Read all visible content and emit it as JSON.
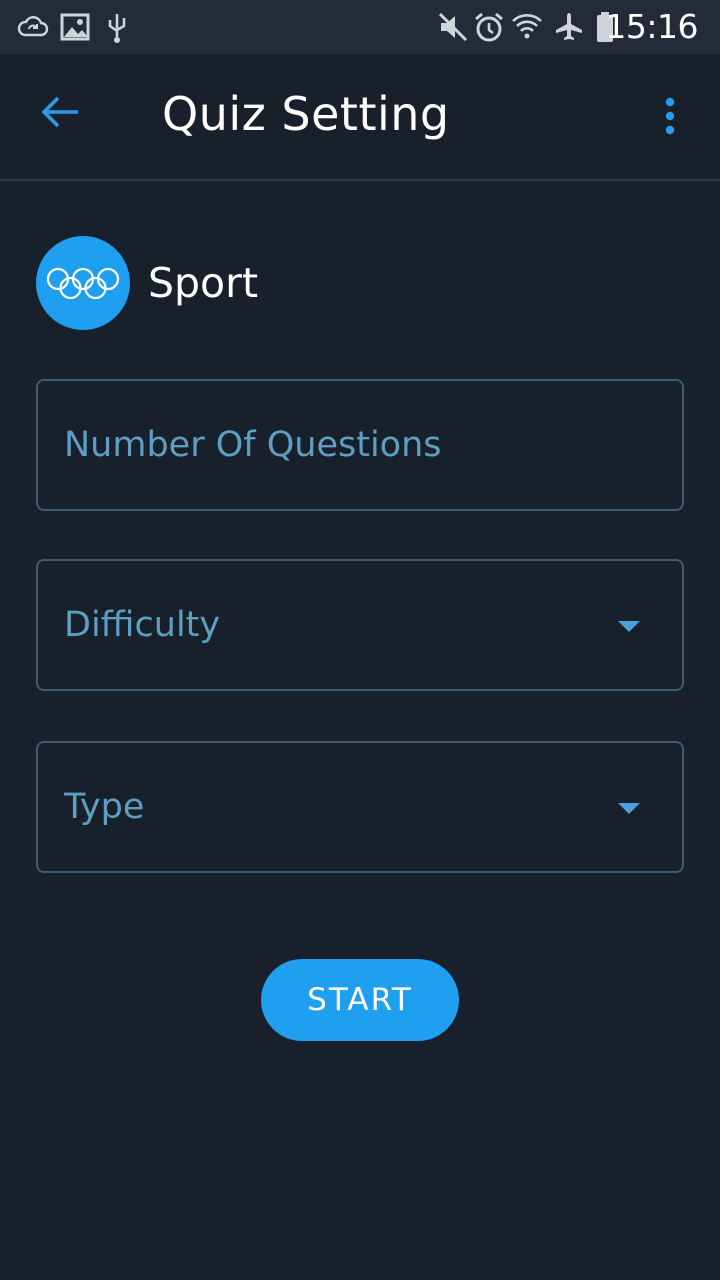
{
  "status_bar": {
    "time": "15:16",
    "icons": [
      "cloud-sync-icon",
      "image-icon",
      "usb-icon",
      "mute-icon",
      "alarm-icon",
      "wifi-icon",
      "airplane-icon",
      "battery-icon"
    ]
  },
  "app_bar": {
    "title": "Quiz Setting",
    "back_icon": "arrow-left-icon",
    "menu_icon": "more-vert-icon"
  },
  "category": {
    "label": "Sport",
    "icon": "olympic-rings-icon"
  },
  "form": {
    "questions_placeholder": "Number Of Questions",
    "difficulty_label": "Difficulty",
    "type_label": "Type"
  },
  "actions": {
    "start_label": "START"
  },
  "colors": {
    "background": "#17202b",
    "status_bar": "#222b37",
    "accent": "#1f9ff0",
    "field_border": "#3c5c74",
    "field_text": "#5e9ec2"
  }
}
